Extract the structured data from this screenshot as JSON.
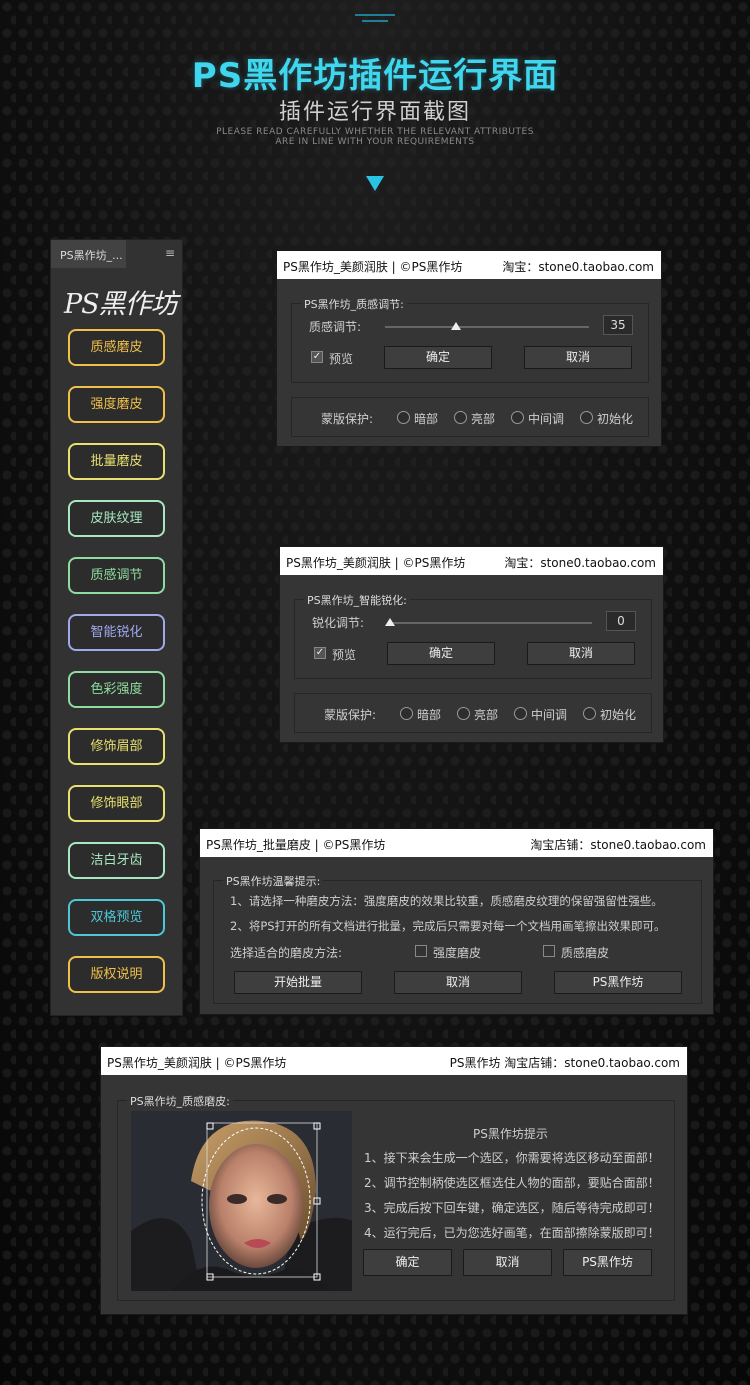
{
  "header": {
    "title": "PS黑作坊插件运行界面",
    "subtitle": "插件运行界面截图",
    "english_line1": "PLEASE READ CAREFULLY WHETHER THE RELEVANT ATTRIBUTES",
    "english_line2": "ARE IN LINE WITH YOUR REQUIREMENTS"
  },
  "sidebar": {
    "tab_label": "PS黑作坊_...",
    "menu_icon": "hamburger-icon",
    "logo": "PS黑作坊",
    "buttons": [
      {
        "label": "质感磨皮",
        "color": "#f0c04a"
      },
      {
        "label": "强度磨皮",
        "color": "#f0c04a"
      },
      {
        "label": "批量磨皮",
        "color": "#e8e070"
      },
      {
        "label": "皮肤纹理",
        "color": "#a8e8c0"
      },
      {
        "label": "质感调节",
        "color": "#8fdca0"
      },
      {
        "label": "智能锐化",
        "color": "#a0a8ee"
      },
      {
        "label": "色彩强度",
        "color": "#8fdca0"
      },
      {
        "label": "修饰眉部",
        "color": "#e8e070"
      },
      {
        "label": "修饰眼部",
        "color": "#e8e070"
      },
      {
        "label": "洁白牙齿",
        "color": "#a8e8c0"
      },
      {
        "label": "双格预览",
        "color": "#4cc8d8"
      },
      {
        "label": "版权说明",
        "color": "#f0c04a"
      }
    ]
  },
  "panel1": {
    "header_left": "PS黑作坊_美颜润肤 | ©PS黑作坊",
    "header_right": "淘宝：stone0.taobao.com",
    "group_title": "PS黑作坊_质感调节:",
    "slider_label": "质感调节:",
    "slider_value": "35",
    "slider_fraction": 0.35,
    "preview_label": "预览",
    "preview_checked": true,
    "ok": "确定",
    "cancel": "取消",
    "mask_label": "蒙版保护:",
    "mask_options": [
      "暗部",
      "亮部",
      "中间调",
      "初始化"
    ]
  },
  "panel2": {
    "header_left": "PS黑作坊_美颜润肤 | ©PS黑作坊",
    "header_right": "淘宝：stone0.taobao.com",
    "group_title": "PS黑作坊_智能锐化:",
    "slider_label": "锐化调节:",
    "slider_value": "0",
    "slider_fraction": 0,
    "preview_label": "预览",
    "preview_checked": true,
    "ok": "确定",
    "cancel": "取消",
    "mask_label": "蒙版保护:",
    "mask_options": [
      "暗部",
      "亮部",
      "中间调",
      "初始化"
    ]
  },
  "panel3": {
    "header_left": "PS黑作坊_批量磨皮 | ©PS黑作坊",
    "header_right": "淘宝店铺：stone0.taobao.com",
    "group_title": "PS黑作坊温馨提示:",
    "tip1": "1、请选择一种磨皮方法：强度磨皮的效果比较重，质感磨皮纹理的保留强留性强些。",
    "tip2": "2、将PS打开的所有文档进行批量，完成后只需要对每一个文档用画笔擦出效果即可。",
    "choose_label": "选择适合的磨皮方法:",
    "option1": "强度磨皮",
    "option2": "质感磨皮",
    "start": "开始批量",
    "cancel": "取消",
    "brand": "PS黑作坊"
  },
  "panel4": {
    "header_left": "PS黑作坊_美颜润肤 | ©PS黑作坊",
    "header_right": "PS黑作坊 淘宝店铺：stone0.taobao.com",
    "group_title": "PS黑作坊_质感磨皮:",
    "tips_title": "PS黑作坊提示",
    "tips": [
      "1、接下来会生成一个选区，你需要将选区移动至面部！",
      "2、调节控制柄使选区框选住人物的面部，要贴合面部！",
      "3、完成后按下回车键，确定选区，随后等待完成即可！",
      "4、运行完后，已为您选好画笔，在面部擦除蒙版即可！"
    ],
    "ok": "确定",
    "cancel": "取消",
    "brand": "PS黑作坊"
  }
}
